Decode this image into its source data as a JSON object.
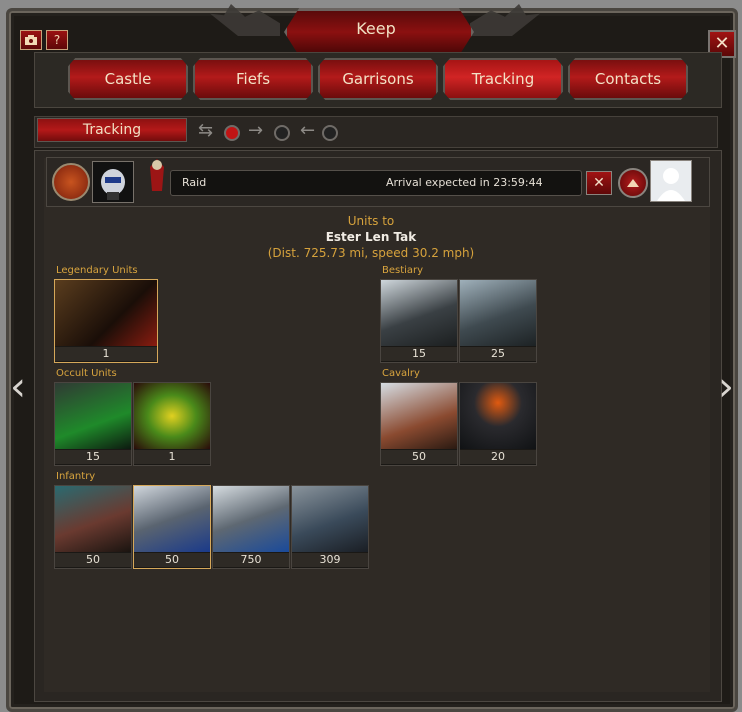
{
  "window": {
    "title": "Keep",
    "close_label": "✕",
    "screenshot_icon": "camera-icon",
    "help_label": "?"
  },
  "tabs": [
    {
      "label": "Castle"
    },
    {
      "label": "Fiefs"
    },
    {
      "label": "Garrisons"
    },
    {
      "label": "Tracking"
    },
    {
      "label": "Contacts"
    }
  ],
  "active_tab": "Tracking",
  "subtab": {
    "label": "Tracking"
  },
  "movement": {
    "type": "Raid",
    "arrival_text": "Arrival expected in 23:59:44",
    "cancel_label": "✕"
  },
  "destination": {
    "heading": "Units to",
    "target": "Ester Len Tak",
    "distance_text": "(Dist. 725.73 mi, speed 30.2 mph)"
  },
  "categories": {
    "legendary": {
      "label": "Legendary Units",
      "units": [
        {
          "count": "1"
        }
      ]
    },
    "bestiary": {
      "label": "Bestiary",
      "units": [
        {
          "count": "15"
        },
        {
          "count": "25"
        }
      ]
    },
    "occult": {
      "label": "Occult Units",
      "units": [
        {
          "count": "15"
        },
        {
          "count": "1"
        }
      ]
    },
    "cavalry": {
      "label": "Cavalry",
      "units": [
        {
          "count": "50"
        },
        {
          "count": "20"
        }
      ]
    },
    "infantry": {
      "label": "Infantry",
      "units": [
        {
          "count": "50"
        },
        {
          "count": "50"
        },
        {
          "count": "750"
        },
        {
          "count": "309"
        }
      ]
    }
  },
  "nav": {
    "prev": "‹",
    "next": "›"
  }
}
